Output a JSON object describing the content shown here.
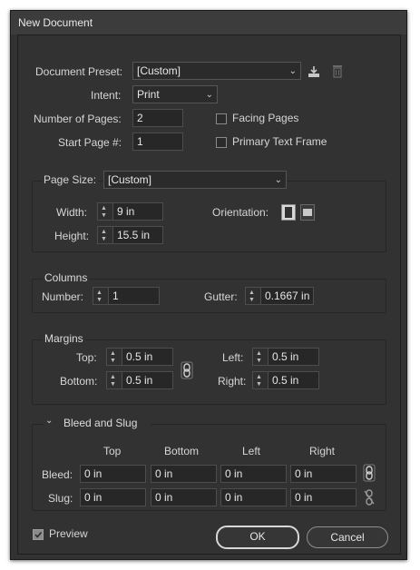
{
  "window": {
    "title": "New Document"
  },
  "preset": {
    "label": "Document Preset:",
    "value": "[Custom]"
  },
  "intent": {
    "label": "Intent:",
    "value": "Print"
  },
  "pages": {
    "label": "Number of Pages:",
    "value": "2"
  },
  "start_page": {
    "label": "Start Page #:",
    "value": "1"
  },
  "facing_pages": {
    "label": "Facing Pages",
    "checked": false
  },
  "primary_text_frame": {
    "label": "Primary Text Frame",
    "checked": false
  },
  "page_size": {
    "label": "Page Size:",
    "value": "[Custom]",
    "width_label": "Width:",
    "width": "9 in",
    "height_label": "Height:",
    "height": "15.5 in",
    "orientation_label": "Orientation:",
    "orientation": "portrait"
  },
  "columns": {
    "title": "Columns",
    "number_label": "Number:",
    "number": "1",
    "gutter_label": "Gutter:",
    "gutter": "0.1667 in"
  },
  "margins": {
    "title": "Margins",
    "top_label": "Top:",
    "top": "0.5 in",
    "bottom_label": "Bottom:",
    "bottom": "0.5 in",
    "left_label": "Left:",
    "left": "0.5 in",
    "right_label": "Right:",
    "right": "0.5 in",
    "linked": true
  },
  "bleed_slug": {
    "title": "Bleed and Slug",
    "expanded": true,
    "columns": [
      "Top",
      "Bottom",
      "Left",
      "Right"
    ],
    "bleed_label": "Bleed:",
    "bleed": [
      "0 in",
      "0 in",
      "0 in",
      "0 in"
    ],
    "bleed_linked": true,
    "slug_label": "Slug:",
    "slug": [
      "0 in",
      "0 in",
      "0 in",
      "0 in"
    ],
    "slug_linked": false
  },
  "preview": {
    "label": "Preview",
    "checked": true
  },
  "buttons": {
    "ok": "OK",
    "cancel": "Cancel"
  },
  "icons": {
    "save_preset": "save-preset-icon",
    "delete_preset": "trash-icon",
    "link": "chain-link-icon",
    "unlink": "broken-chain-icon"
  },
  "colors": {
    "panel": "#323232",
    "field": "#272727",
    "border": "#4d4d4d",
    "text": "#d6d6d6"
  }
}
